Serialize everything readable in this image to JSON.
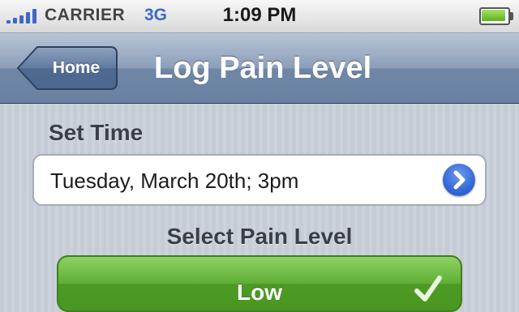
{
  "status_bar": {
    "carrier": "CARRIER",
    "network": "3G",
    "time": "1:09 PM",
    "signal_bars": 5,
    "battery_icon": "battery-full-icon"
  },
  "nav_bar": {
    "back_label": "Home",
    "title": "Log Pain Level"
  },
  "time_section": {
    "label": "Set Time",
    "value": "Tuesday, March 20th; 3pm",
    "icon": "disclosure-arrow-icon"
  },
  "pain_section": {
    "label": "Select Pain Level",
    "options": [
      {
        "label": "Low",
        "selected": true,
        "color": "#5fae35"
      }
    ]
  },
  "colors": {
    "nav_bar": "#6f86a5",
    "accent_blue": "#3468d8",
    "low_green": "#5fae35"
  }
}
